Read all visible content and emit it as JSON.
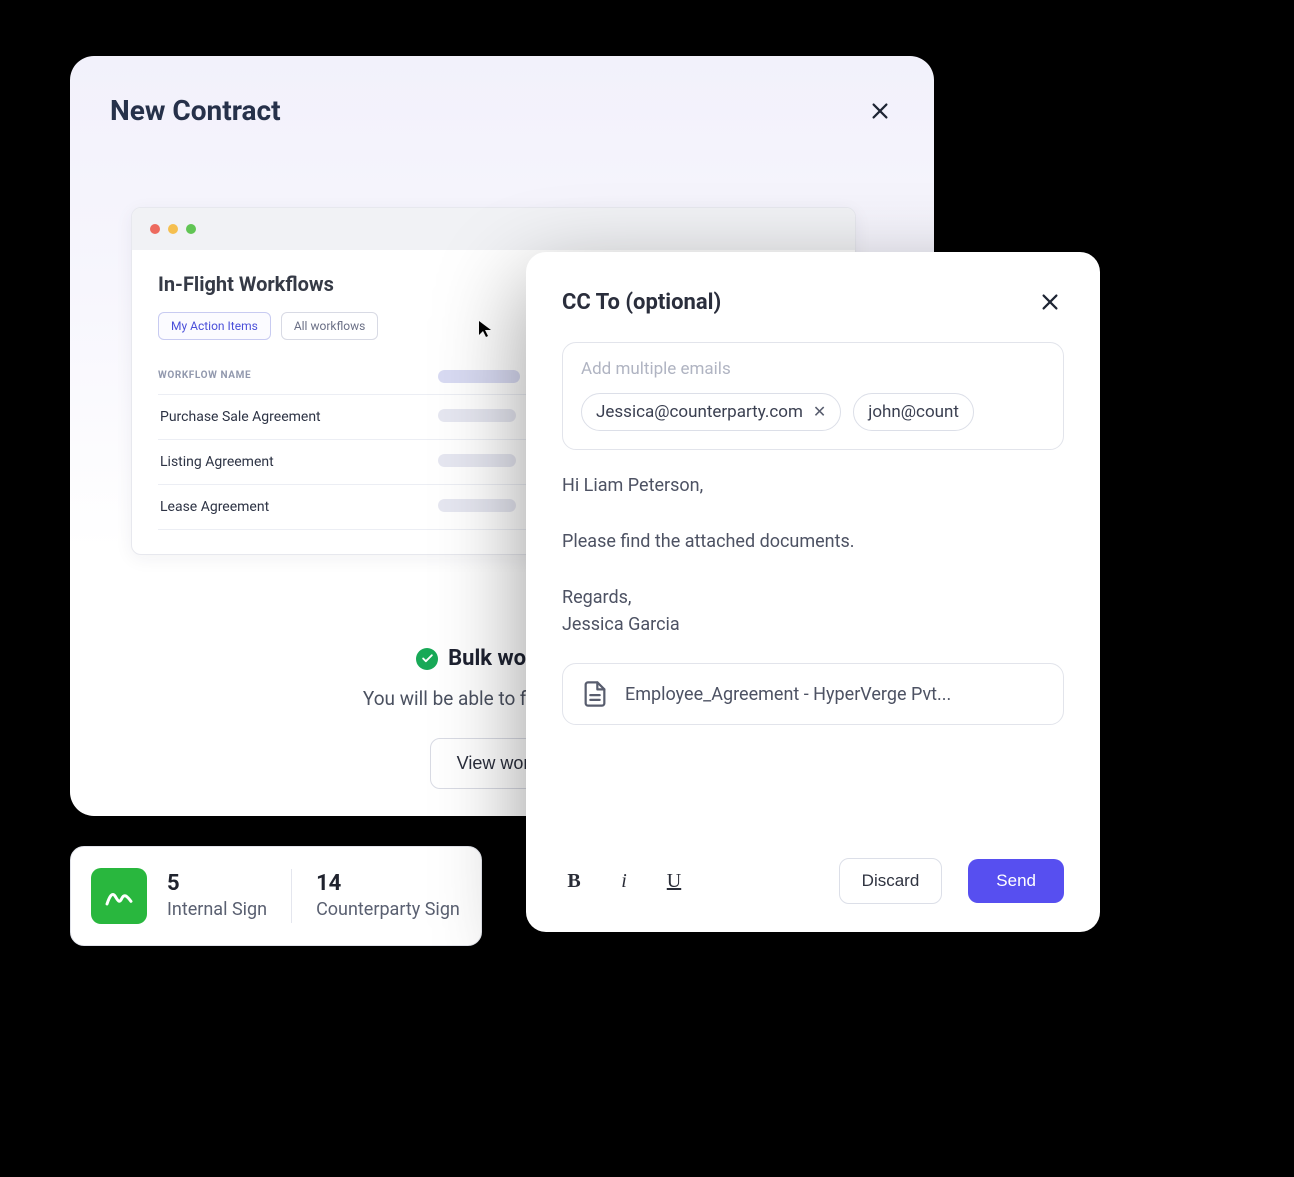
{
  "modal": {
    "title": "New Contract",
    "success_title": "Bulk workflow",
    "success_subtitle": "You will be able to find them in th",
    "view_button": "View workfl"
  },
  "workflows": {
    "title": "In-Flight Workflows",
    "tabs": [
      {
        "label": "My Action Items",
        "active": true
      },
      {
        "label": "All workflows",
        "active": false
      }
    ],
    "column_header": "WORKFLOW NAME",
    "rows": [
      "Purchase Sale Agreement",
      "Listing Agreement",
      "Lease Agreement"
    ]
  },
  "stats": {
    "internal": {
      "count": "5",
      "label": "Internal Sign"
    },
    "counterparty": {
      "count": "14",
      "label": "Counterparty Sign"
    }
  },
  "compose": {
    "title": "CC To (optional)",
    "hint": "Add multiple emails",
    "chips": [
      "Jessica@counterparty.com",
      "john@count"
    ],
    "body_greeting": "Hi Liam Peterson,",
    "body_line": "Please find the attached documents.",
    "body_signoff": "Regards,",
    "body_name": "Jessica Garcia",
    "attachment": "Employee_Agreement - HyperVerge Pvt...",
    "discard": "Discard",
    "send": "Send"
  }
}
